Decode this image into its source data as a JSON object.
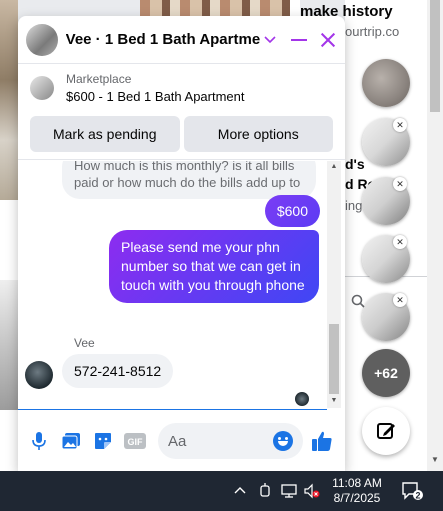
{
  "background": {
    "headline": "make history",
    "site": "ourtrip.co",
    "post_line1": "d's",
    "post_line2": "d Ro",
    "post_line3": "ing"
  },
  "chat": {
    "title": "Vee · 1 Bed 1 Bath Apartme...",
    "listing": {
      "source": "Marketplace",
      "summary": "$600 - 1 Bed 1 Bath Apartment",
      "mark_pending_label": "Mark as pending",
      "more_options_label": "More options"
    },
    "messages": [
      {
        "from": "Vee",
        "text": "How much is this monthly? is it all bills paid or how much do the bills add up to"
      },
      {
        "from": "me",
        "text": "$600"
      },
      {
        "from": "me",
        "text": "Please send me your phn number so that we can get in touch with you through phone"
      },
      {
        "from": "Vee",
        "text": "572-241-8512"
      }
    ],
    "sender_name": "Vee",
    "composer_placeholder": "Aa"
  },
  "chat_heads": {
    "more_count": "+62"
  },
  "taskbar": {
    "time": "11:08 AM",
    "date": "8/7/2025",
    "notification_count": "2"
  },
  "colors": {
    "accent": "#a335e9",
    "messenger_blue": "#1b74e4",
    "bubble_start": "#8d2cf0",
    "bubble_end": "#3f47f4"
  },
  "icons": [
    "chevron-down-icon",
    "minimize-icon",
    "close-icon",
    "microphone-icon",
    "photo-icon",
    "sticker-icon",
    "gif-icon",
    "emoji-icon",
    "like-icon",
    "compose-icon",
    "search-icon",
    "wifi-icon",
    "volume-muted-icon",
    "notification-icon"
  ]
}
